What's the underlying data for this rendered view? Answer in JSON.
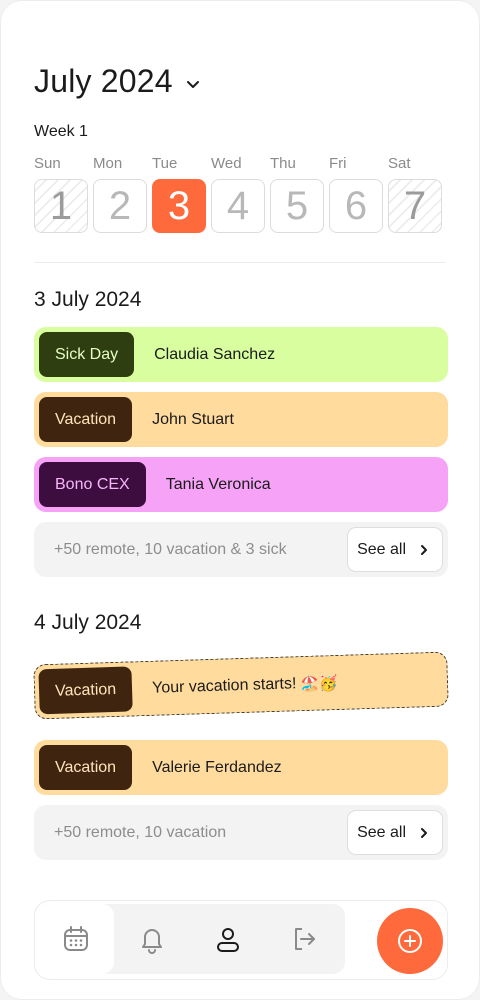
{
  "header": {
    "month": "July 2024",
    "week": "Week 1"
  },
  "days": [
    {
      "name": "Sun",
      "num": "1",
      "state": "weekend"
    },
    {
      "name": "Mon",
      "num": "2",
      "state": "normal"
    },
    {
      "name": "Tue",
      "num": "3",
      "state": "active"
    },
    {
      "name": "Wed",
      "num": "4",
      "state": "normal"
    },
    {
      "name": "Thu",
      "num": "5",
      "state": "normal"
    },
    {
      "name": "Fri",
      "num": "6",
      "state": "normal"
    },
    {
      "name": "Sat",
      "num": "7",
      "state": "weekend"
    }
  ],
  "sections": [
    {
      "date": "3 July 2024",
      "entries": [
        {
          "tag": "Sick Day",
          "name": "Claudia Sanchez",
          "color": "green"
        },
        {
          "tag": "Vacation",
          "name": "John Stuart",
          "color": "orange"
        },
        {
          "tag": "Bono CEX",
          "name": "Tania Veronica",
          "color": "pink"
        }
      ],
      "summary": "+50 remote, 10 vacation & 3 sick",
      "see_all": "See all"
    },
    {
      "date": "4 July 2024",
      "highlight": {
        "tag": "Vacation",
        "text": "Your vacation starts!",
        "emoji": "🏖️🥳"
      },
      "entries": [
        {
          "tag": "Vacation",
          "name": "Valerie Ferdandez",
          "color": "orange"
        }
      ],
      "summary": "+50 remote, 10 vacation",
      "see_all": "See all"
    }
  ],
  "nav": {
    "items": [
      "calendar-icon",
      "bell-icon",
      "user-icon",
      "logout-icon"
    ],
    "active": "calendar-icon",
    "fab_icon": "plus-circle-icon"
  },
  "colors": {
    "accent": "#ff6a3d",
    "sick_bg": "#d8fe9f",
    "vacation_bg": "#ffdb9e",
    "bono_bg": "#f5a2f7"
  }
}
